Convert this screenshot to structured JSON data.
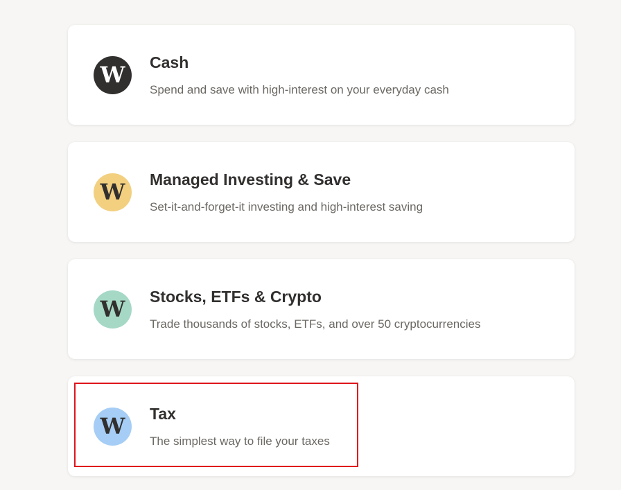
{
  "colors": {
    "page_background": "#f7f6f4",
    "card_background": "#ffffff",
    "title_text": "#32302f",
    "description_text": "#6b6863",
    "highlight_border": "#e0141c"
  },
  "products": [
    {
      "title": "Cash",
      "description": "Spend and save with high-interest on your everyday cash",
      "logo_letter": "W",
      "logo_bg": "#32302f",
      "logo_fg": "#ffffff"
    },
    {
      "title": "Managed Investing & Save",
      "description": "Set-it-and-forget-it investing and high-interest saving",
      "logo_letter": "W",
      "logo_bg": "#f2d080",
      "logo_fg": "#32302f"
    },
    {
      "title": "Stocks, ETFs & Crypto",
      "description": "Trade thousands of stocks, ETFs, and over 50 cryptocurrencies",
      "logo_letter": "W",
      "logo_bg": "#a6d8c6",
      "logo_fg": "#32302f"
    },
    {
      "title": "Tax",
      "description": "The simplest way to file your taxes",
      "logo_letter": "W",
      "logo_bg": "#a5cdf5",
      "logo_fg": "#32302f"
    }
  ]
}
